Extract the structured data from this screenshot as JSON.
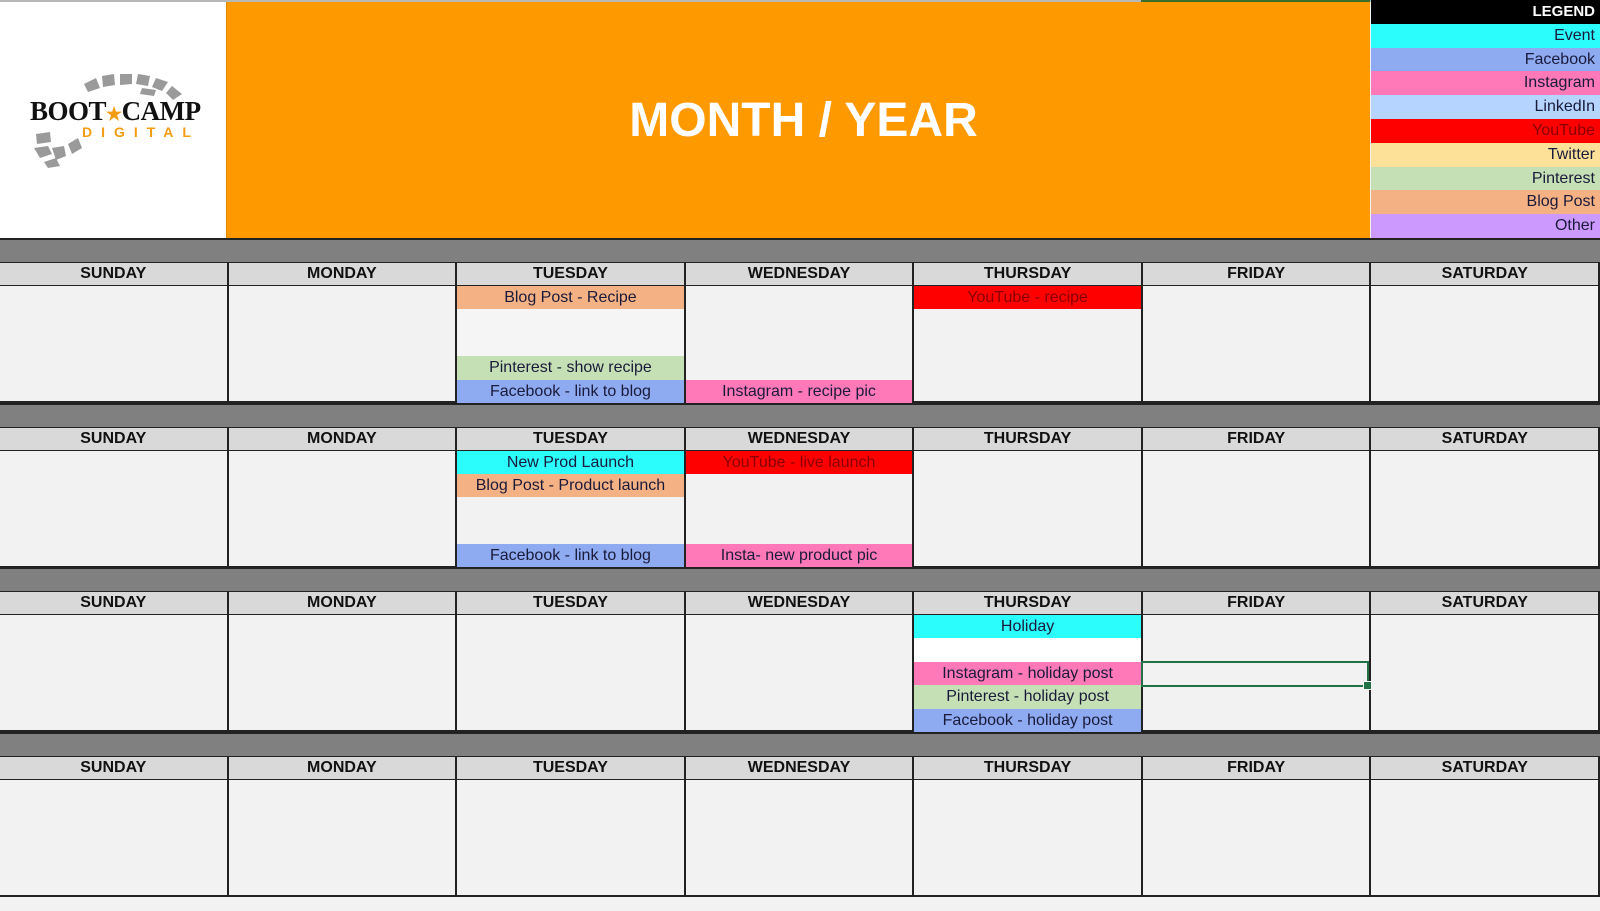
{
  "header": {
    "title": "MONTH / YEAR",
    "logo": {
      "line1_left": "BOOT",
      "line1_right": "CAMP",
      "line2": "DIGITAL"
    }
  },
  "legend": {
    "title": "LEGEND",
    "items": [
      {
        "label": "Event",
        "color": "#2bfdfd",
        "text": "#1a1a3a"
      },
      {
        "label": "Facebook",
        "color": "#8eaaf0",
        "text": "#1a1a3a"
      },
      {
        "label": "Instagram",
        "color": "#ff79b8",
        "text": "#1a1a3a"
      },
      {
        "label": "LinkedIn",
        "color": "#b5d4ff",
        "text": "#1a1a3a"
      },
      {
        "label": "YouTube",
        "color": "#ff0000",
        "text": "#8a0000"
      },
      {
        "label": "Twitter",
        "color": "#fde199",
        "text": "#1a1a3a"
      },
      {
        "label": "Pinterest",
        "color": "#c6e0b5",
        "text": "#1a1a3a"
      },
      {
        "label": "Blog Post",
        "color": "#f4b183",
        "text": "#1a1a3a"
      },
      {
        "label": "Other",
        "color": "#cc99ff",
        "text": "#1a1a3a"
      }
    ]
  },
  "days": [
    "SUNDAY",
    "MONDAY",
    "TUESDAY",
    "WEDNESDAY",
    "THURSDAY",
    "FRIDAY",
    "SATURDAY"
  ],
  "weeks": [
    {
      "entries": [
        {
          "day": 2,
          "slot": 0,
          "text": "Blog Post - Recipe",
          "type": "Blog Post"
        },
        {
          "day": 2,
          "slot": 3,
          "text": "Pinterest - show recipe",
          "type": "Pinterest"
        },
        {
          "day": 2,
          "slot": 4,
          "text": "Facebook - link to blog",
          "type": "Facebook"
        },
        {
          "day": 3,
          "slot": 4,
          "text": "Instagram - recipe pic",
          "type": "Instagram"
        },
        {
          "day": 4,
          "slot": 0,
          "text": "YouTube - recipe",
          "type": "YouTube"
        }
      ]
    },
    {
      "entries": [
        {
          "day": 2,
          "slot": 0,
          "text": "New Prod Launch",
          "type": "Event"
        },
        {
          "day": 2,
          "slot": 1,
          "text": "Blog Post - Product launch",
          "type": "Blog Post"
        },
        {
          "day": 2,
          "slot": 4,
          "text": "Facebook - link to blog",
          "type": "Facebook"
        },
        {
          "day": 3,
          "slot": 0,
          "text": "YouTube - live launch",
          "type": "YouTube"
        },
        {
          "day": 3,
          "slot": 4,
          "text": "Insta- new product pic",
          "type": "Instagram"
        }
      ]
    },
    {
      "entries": [
        {
          "day": 4,
          "slot": 0,
          "text": "Holiday",
          "type": "Event"
        },
        {
          "day": 4,
          "slot": 2,
          "text": "Instagram - holiday post",
          "type": "Instagram"
        },
        {
          "day": 4,
          "slot": 3,
          "text": "Pinterest - holiday post",
          "type": "Pinterest"
        },
        {
          "day": 4,
          "slot": 4,
          "text": "Facebook - holiday post",
          "type": "Facebook"
        }
      ],
      "selected": {
        "day": 5,
        "slot": 2
      }
    },
    {
      "entries": []
    }
  ],
  "colors": {
    "header_orange": "#ff9900",
    "band_gray": "#808080",
    "day_header_gray": "#d9d9d9",
    "cell_bg": "#f2f2f2",
    "selection_green": "#217346"
  }
}
